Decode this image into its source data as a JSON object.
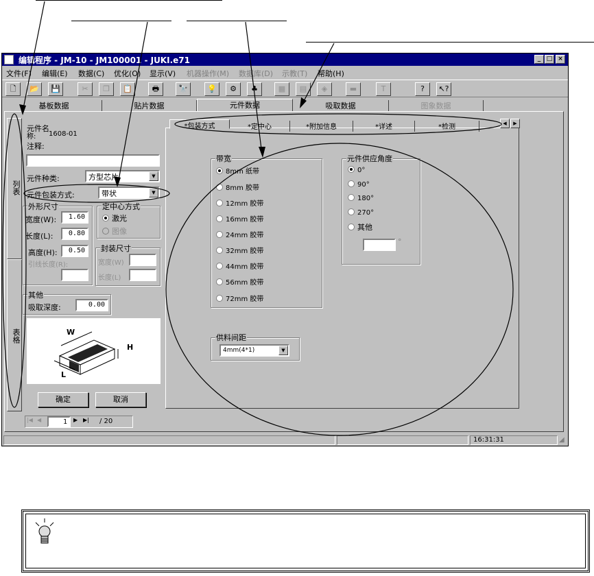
{
  "window": {
    "title": "编辑程序  - JM-10 - JM100001 - JUKI.e71",
    "controls": [
      "_",
      "□",
      "×"
    ]
  },
  "menu": [
    "文件(F)",
    "编辑(E)",
    "数据(C)",
    "优化(O)",
    "显示(V)",
    "机器操作(M)",
    "数据库(D)",
    "示教(T)",
    "帮助(H)"
  ],
  "main_tabs": [
    "基板数据",
    "贴片数据",
    "元件数据",
    "吸取数据",
    "图象数据"
  ],
  "side_tabs": [
    "列表",
    "表格"
  ],
  "component": {
    "name_label": "元件名",
    "name_prefix": "称:",
    "name_value": "1608-01",
    "comment_label": "注释:",
    "comment_value": "",
    "type_label": "元件种类:",
    "type_value": "方型芯片",
    "package_label": "元件包装方式:",
    "package_value": "带状"
  },
  "outline": {
    "title": "外形尺寸",
    "width_label": "宽度(W):",
    "width_value": "1.60",
    "length_label": "长度(L):",
    "length_value": "0.80",
    "height_label": "高度(H):",
    "height_value": "0.50",
    "lead_label": "引线长度(R):",
    "lead_value": ""
  },
  "centering": {
    "title": "定中心方式",
    "laser": "激光",
    "image": "图像"
  },
  "package_size": {
    "title": "封装尺寸",
    "width_label": "宽度(W)",
    "length_label": "长度(L)"
  },
  "other": {
    "title": "其他",
    "pick_depth_label": "吸取深度:",
    "pick_depth_value": "0.00"
  },
  "diagram": {
    "w": "W",
    "h": "H",
    "l": "L"
  },
  "buttons": {
    "ok": "确定",
    "cancel": "取消"
  },
  "pager": {
    "current": "1",
    "total": "/ 20"
  },
  "sub_tabs": [
    "*包装方式",
    "*定中心",
    "*附加信息",
    "*详述",
    "*检测"
  ],
  "tape": {
    "title": "带宽",
    "options": [
      "8mm  纸带",
      "8mm  胶带",
      "12mm 胶带",
      "16mm 胶带",
      "24mm 胶带",
      "32mm 胶带",
      "44mm 胶带",
      "56mm 胶带",
      "72mm 胶带"
    ]
  },
  "feed_angle": {
    "title": "元件供应角度",
    "options": [
      "0°",
      "90°",
      "180°",
      "270°",
      "其他"
    ],
    "other_value": "",
    "degree_sign": "°"
  },
  "feed_pitch": {
    "title": "供料间距",
    "value": "4mm(4*1)"
  },
  "status": {
    "time": "16:31:31"
  }
}
